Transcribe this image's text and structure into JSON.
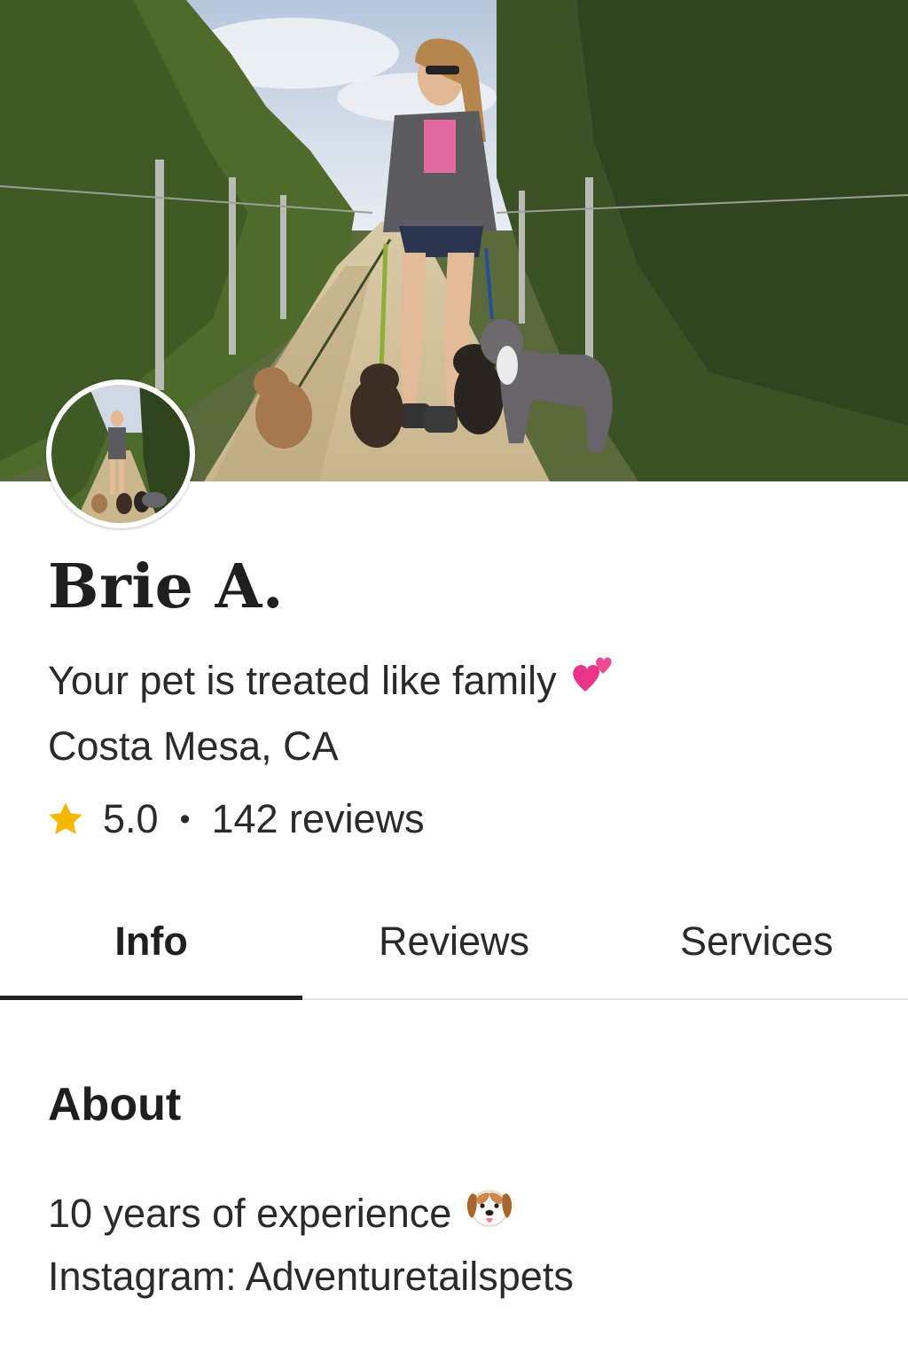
{
  "profile": {
    "name": "Brie A.",
    "tagline": "Your pet is treated like family",
    "tagline_icon": "two-hearts-icon",
    "location": "Costa Mesa, CA",
    "rating": "5.0",
    "rating_separator": "•",
    "reviews": "142 reviews",
    "star_color": "#f5b800"
  },
  "tabs": [
    {
      "label": "Info",
      "active": true
    },
    {
      "label": "Reviews",
      "active": false
    },
    {
      "label": "Services",
      "active": false
    }
  ],
  "about": {
    "title": "About",
    "experience": "10 years of experience",
    "experience_icon": "dog-face-icon",
    "instagram": "Instagram: Adventuretailspets"
  }
}
